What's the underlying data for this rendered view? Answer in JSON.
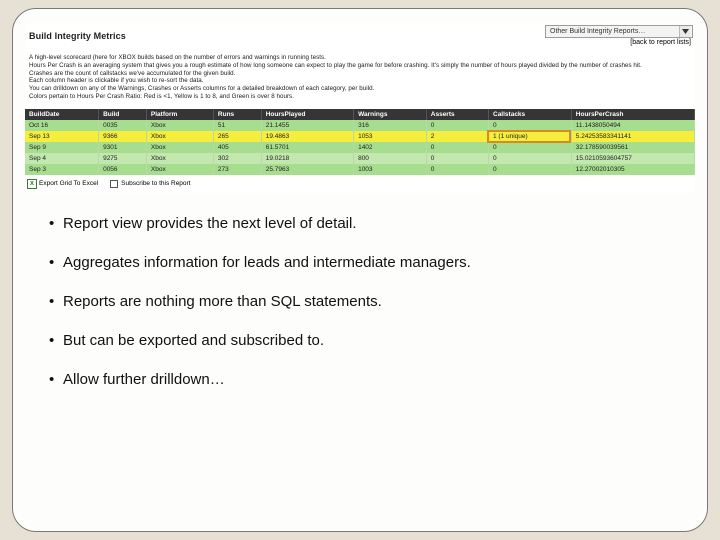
{
  "report": {
    "title": "Build Integrity Metrics",
    "dropdown_value": "Other Build Integrity Reports…",
    "back_link": "[back to report lists]",
    "desc_lines": [
      "A high-level scorecard (here for XBOX builds based on the number of errors and warnings in running tests.",
      "Hours Per Crash is an averaging system that gives you a rough estimate of how long someone can expect to play the game for before crashing. It's simply the number of hours played divided by the number of crashes hit.",
      "Crashes are the count of callstacks we've accumulated for the given build.",
      "Each column header is clickable if you wish to re-sort the data.",
      "You can drilldown on any of the Warnings, Crashes or Asserts columns for a detailed breakdown of each category, per build.",
      "Colors pertain to Hours Per Crash Ratio: Red is <1, Yellow is 1 to 8, and Green is over 8 hours."
    ],
    "columns": [
      "BuildDate",
      "Build",
      "Platform",
      "Runs",
      "HoursPlayed",
      "Warnings",
      "Asserts",
      "Callstacks",
      "HoursPerCrash"
    ],
    "rows": [
      {
        "date": "Oct 16",
        "build": "0035",
        "platform": "Xbox",
        "runs": "51",
        "hours": "21.1455",
        "warnings": "316",
        "asserts": "0",
        "callstacks": "0",
        "hpc": "11.1438050494"
      },
      {
        "date": "Sep 13",
        "build": "9366",
        "platform": "Xbox",
        "runs": "265",
        "hours": "19.4863",
        "warnings": "1053",
        "asserts": "2",
        "callstacks": "1 (1 unique)",
        "hpc": "5.24253583341141"
      },
      {
        "date": "Sep 9",
        "build": "9301",
        "platform": "Xbox",
        "runs": "405",
        "hours": "61.5701",
        "warnings": "1402",
        "asserts": "0",
        "callstacks": "0",
        "hpc": "32.178590039561"
      },
      {
        "date": "Sep 4",
        "build": "9275",
        "platform": "Xbox",
        "runs": "302",
        "hours": "19.0218",
        "warnings": "800",
        "asserts": "0",
        "callstacks": "0",
        "hpc": "15.0210593604757"
      },
      {
        "date": "Sep 3",
        "build": "0056",
        "platform": "Xbox",
        "runs": "273",
        "hours": "25.7963",
        "warnings": "1003",
        "asserts": "0",
        "callstacks": "0",
        "hpc": "12.27002010305"
      }
    ],
    "export_label": "Export Grid To Excel",
    "subscribe_label": "Subscribe to this Report"
  },
  "bullets": [
    "Report view provides the next level of detail.",
    "Aggregates information for leads and intermediate managers.",
    "Reports are nothing more than SQL statements.",
    "But can be exported and subscribed to.",
    "Allow further drilldown…"
  ]
}
